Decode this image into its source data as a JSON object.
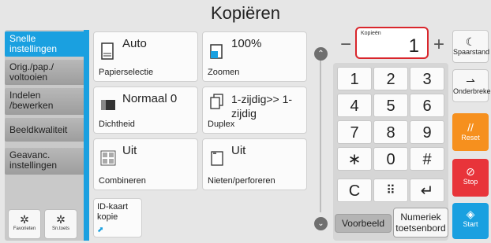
{
  "title": "Kopiëren",
  "sidebar": {
    "items": [
      {
        "label": "Snelle instellingen"
      },
      {
        "label": "Orig./pap./ voltooien"
      },
      {
        "label": "Indelen /bewerken"
      },
      {
        "label": "Beeldkwaliteit"
      },
      {
        "label": "Geavanc. instellingen"
      }
    ],
    "favorites_label": "Favorieten",
    "shortcut_label": "Sn.toets"
  },
  "tiles": {
    "paper": {
      "value": "Auto",
      "label": "Papierselectie"
    },
    "zoom": {
      "value": "100%",
      "label": "Zoomen"
    },
    "density": {
      "value": "Normaal 0",
      "label": "Dichtheid"
    },
    "duplex": {
      "value": "1-zijdig>> 1-zijdig",
      "label": "Duplex"
    },
    "combine": {
      "value": "Uit",
      "label": "Combineren"
    },
    "staple": {
      "value": "Uit",
      "label": "Nieten/perforeren"
    },
    "idcard": {
      "label": "ID-kaart kopie"
    }
  },
  "copies": {
    "label": "Kopieën",
    "value": "1",
    "minus": "−",
    "plus": "+"
  },
  "keypad": {
    "keys": [
      "1",
      "2",
      "3",
      "4",
      "5",
      "6",
      "7",
      "8",
      "9",
      "∗",
      "0",
      "#",
      "C",
      "⠿",
      "↵"
    ]
  },
  "bottom": {
    "preview": "Voorbeeld",
    "numeric": "Numeriek toetsenbord"
  },
  "right": {
    "sleep": "Spaarstand",
    "interrupt": "Onderbreken",
    "reset": "Reset",
    "stop": "Stop",
    "start": "Start"
  },
  "colors": {
    "accent": "#1aa0e0",
    "highlight": "#d9262c",
    "reset": "#f6901e",
    "stop": "#e8343a"
  }
}
